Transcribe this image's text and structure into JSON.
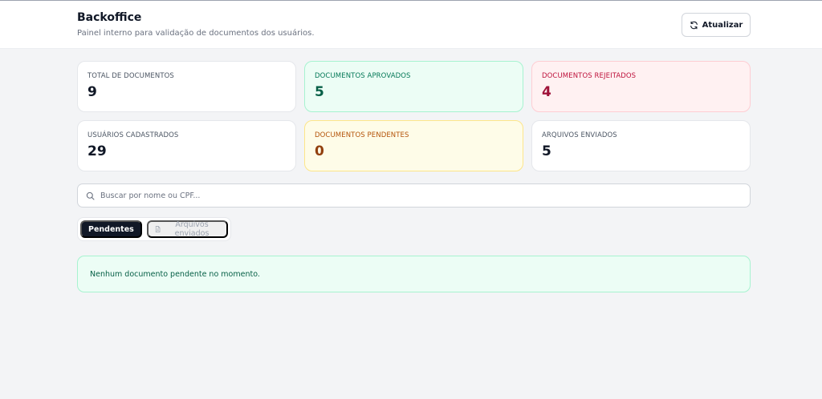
{
  "header": {
    "title": "Backoffice",
    "subtitle": "Painel interno para validação de documentos dos usuários.",
    "refresh_label": "Atualizar"
  },
  "stats": [
    {
      "label": "TOTAL DE DOCUMENTOS",
      "value": "9",
      "tone": "neutral"
    },
    {
      "label": "DOCUMENTOS APROVADOS",
      "value": "5",
      "tone": "green"
    },
    {
      "label": "DOCUMENTOS REJEITADOS",
      "value": "4",
      "tone": "red"
    },
    {
      "label": "USUÁRIOS CADASTRADOS",
      "value": "29",
      "tone": "neutral"
    },
    {
      "label": "DOCUMENTOS PENDENTES",
      "value": "0",
      "tone": "yellow"
    },
    {
      "label": "ARQUIVOS ENVIADOS",
      "value": "5",
      "tone": "neutral"
    }
  ],
  "search": {
    "placeholder": "Buscar por nome ou CPF...",
    "value": ""
  },
  "tabs": [
    {
      "label": "Pendentes",
      "active": true
    },
    {
      "label": "Arquivos enviados",
      "active": false,
      "icon": "document-icon"
    }
  ],
  "empty_state": {
    "message": "Nenhum documento pendente no momento."
  },
  "colors": {
    "background": "#f3f4f6",
    "green_bg": "#ecfdf5",
    "red_bg": "#fff1f2",
    "yellow_bg": "#fefce8",
    "active_tab": "#111827"
  }
}
